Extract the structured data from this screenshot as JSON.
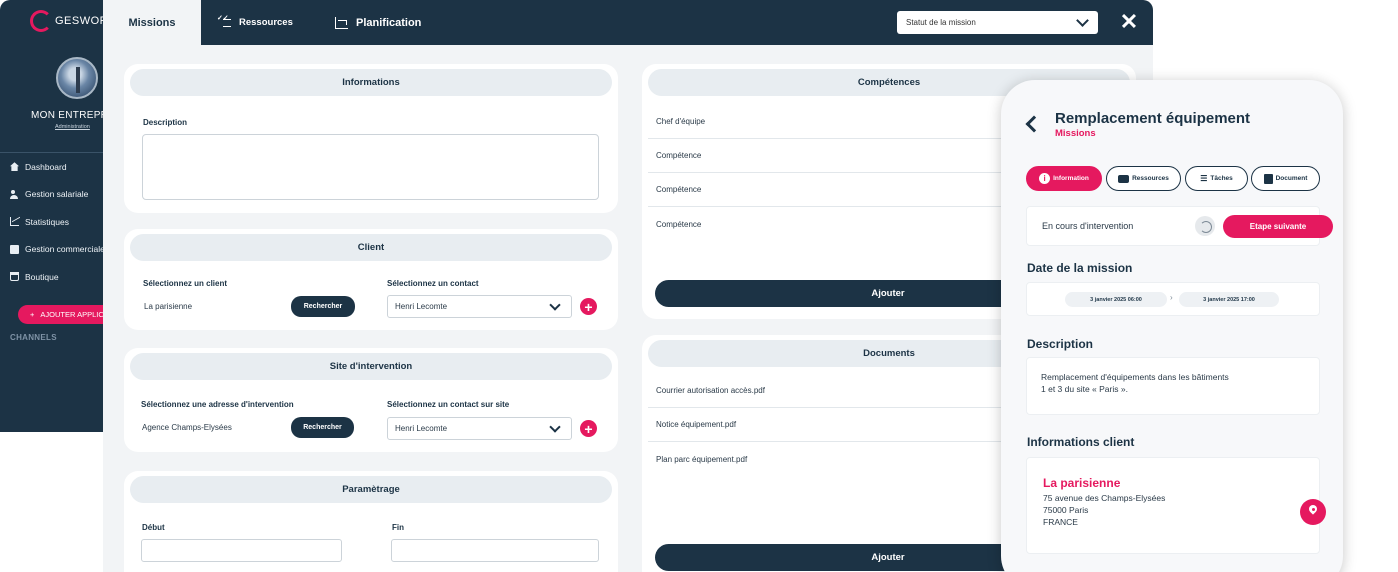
{
  "sidebar": {
    "brand": "GESWORK",
    "company": "MON ENTREPRISE",
    "role": "Administration",
    "nav": [
      {
        "label": "Dashboard",
        "icon": "home-icon"
      },
      {
        "label": "Gestion salariale",
        "icon": "users-icon"
      },
      {
        "label": "Statistiques",
        "icon": "chart-icon"
      },
      {
        "label": "Gestion commerciale",
        "icon": "money-icon"
      },
      {
        "label": "Boutique",
        "icon": "cart-icon"
      }
    ],
    "add_app": "AJOUTER APPLICATION",
    "channels": "CHANNELS"
  },
  "topbar": {
    "tabs": [
      "Missions",
      "Ressources",
      "Planification"
    ],
    "status_placeholder": "Statut de la mission"
  },
  "informations": {
    "title": "Informations",
    "description_label": "Description"
  },
  "client": {
    "title": "Client",
    "select_client_label": "Sélectionnez un client",
    "client_value": "La parisienne",
    "search_button": "Rechercher",
    "select_contact_label": "Sélectionnez un contact",
    "contact_value": "Henri Lecomte"
  },
  "site": {
    "title": "Site d'intervention",
    "address_label": "Sélectionnez une adresse d'intervention",
    "address_value": "Agence Champs-Elysées",
    "search_button": "Rechercher",
    "contact_label": "Sélectionnez un contact sur site",
    "contact_value": "Henri Lecomte"
  },
  "parametrage": {
    "title": "Paramètrage",
    "start_label": "Début",
    "end_label": "Fin"
  },
  "competences": {
    "title": "Compétences",
    "rows": [
      "Chef d'équipe",
      "Compétence",
      "Compétence",
      "Compétence"
    ],
    "add_button": "Ajouter"
  },
  "documents": {
    "title": "Documents",
    "rows": [
      "Courrier autorisation accès.pdf",
      "Notice équipement.pdf",
      "Plan parc équipement.pdf"
    ],
    "add_button": "Ajouter"
  },
  "mobile": {
    "title": "Remplacement équipement",
    "subtitle": "Missions",
    "tabs": [
      "Information",
      "Ressources",
      "Tâches",
      "Document"
    ],
    "status_text": "En cours d'intervention",
    "next_step": "Etape suivante",
    "date_heading": "Date de la mission",
    "date_start": "3 janvier 2025 06:00",
    "date_end": "3 janvier 2025 17:00",
    "description_heading": "Description",
    "description_line1": "Remplacement d'équipements dans les bâtiments",
    "description_line2": "1 et 3 du site « Paris ».",
    "client_heading": "Informations client",
    "client_name": "La parisienne",
    "address_line1": "75 avenue des Champs-Elysées",
    "address_line2": "75000 Paris",
    "address_line3": "FRANCE"
  },
  "colors": {
    "primary": "#1c3345",
    "accent": "#e5195f",
    "background": "#f2f4f6"
  }
}
